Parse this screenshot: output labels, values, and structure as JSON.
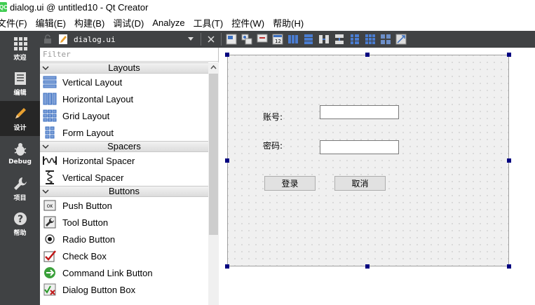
{
  "window": {
    "title": "dialog.ui @ untitled10 - Qt Creator",
    "logo_text": "QC"
  },
  "menu": [
    "文件(F)",
    "编辑(E)",
    "构建(B)",
    "调试(D)",
    "Analyze",
    "工具(T)",
    "控件(W)",
    "帮助(H)"
  ],
  "modes": [
    {
      "label": "欢迎",
      "icon": "grid-icon"
    },
    {
      "label": "编辑",
      "icon": "document-icon"
    },
    {
      "label": "设计",
      "icon": "pencil-icon"
    },
    {
      "label": "Debug",
      "icon": "bug-icon"
    },
    {
      "label": "项目",
      "icon": "wrench-icon"
    },
    {
      "label": "帮助",
      "icon": "help-icon"
    }
  ],
  "toolbar": {
    "document_name": "dialog.ui"
  },
  "widget_box": {
    "filter_placeholder": "Filter",
    "categories": [
      {
        "name": "Layouts",
        "items": [
          "Vertical Layout",
          "Horizontal Layout",
          "Grid Layout",
          "Form Layout"
        ]
      },
      {
        "name": "Spacers",
        "items": [
          "Horizontal Spacer",
          "Vertical Spacer"
        ]
      },
      {
        "name": "Buttons",
        "items": [
          "Push Button",
          "Tool Button",
          "Radio Button",
          "Check Box",
          "Command Link Button",
          "Dialog Button Box"
        ]
      }
    ]
  },
  "form": {
    "account_label": "账号:",
    "password_label": "密码:",
    "login_button": "登录",
    "cancel_button": "取消"
  },
  "colors": {
    "sidebar": "#404244",
    "active_mode": "#262626",
    "handle": "#000080",
    "form_bg": "#f0f0f0"
  }
}
